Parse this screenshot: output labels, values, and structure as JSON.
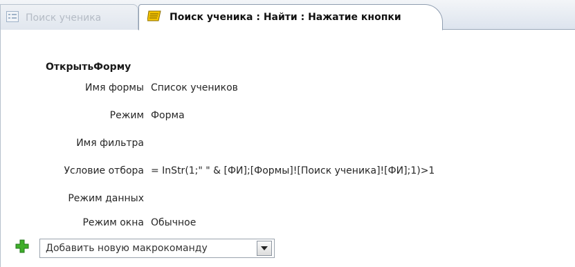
{
  "tabs": [
    {
      "label": "Поиск ученика",
      "icon": "form-icon",
      "active": false
    },
    {
      "label": "Поиск ученика : Найти : Нажатие кнопки",
      "icon": "macro-icon",
      "active": true
    }
  ],
  "macro": {
    "action": "ОткрытьФорму",
    "arguments": [
      {
        "label": "Имя формы",
        "value": "Список учеников"
      },
      {
        "label": "Режим",
        "value": "Форма"
      },
      {
        "label": "Имя фильтра",
        "value": ""
      },
      {
        "label": "Условие отбора",
        "value": "= InStr(1;\" \" & [ФИ];[Формы]![Поиск ученика]![ФИ];1)>1"
      },
      {
        "label": "Режим данных",
        "value": ""
      },
      {
        "label": "Режим окна",
        "value": "Обычное"
      }
    ]
  },
  "add_action": {
    "placeholder": "Добавить новую макрокоманду",
    "icon": "add-plus-icon",
    "dropdown_icon": "chevron-down-icon"
  },
  "colors": {
    "tab_inactive_text": "#b4bbc5",
    "plus_green": "#3fae2a",
    "macro_icon_yellow": "#f5c400"
  }
}
